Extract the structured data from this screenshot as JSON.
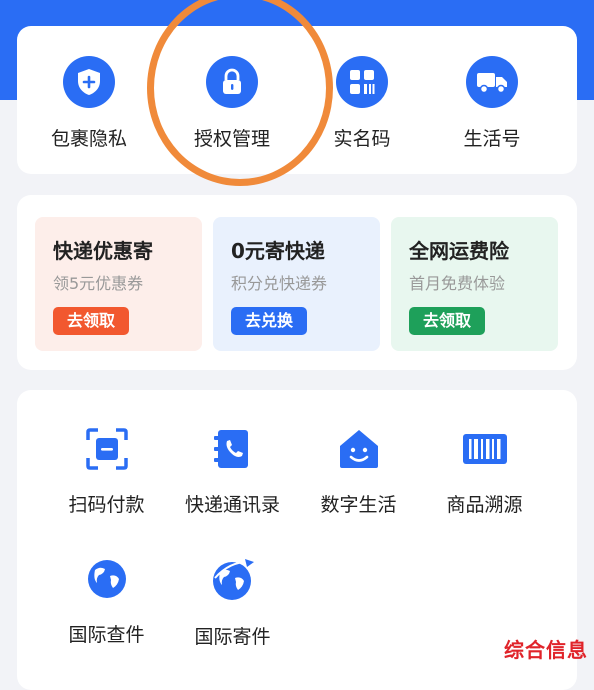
{
  "quick_access": [
    {
      "label": "包裹隐私",
      "icon": "shield-plus-icon"
    },
    {
      "label": "授权管理",
      "icon": "lock-icon"
    },
    {
      "label": "实名码",
      "icon": "qr-grid-icon"
    },
    {
      "label": "生活号",
      "icon": "truck-icon"
    }
  ],
  "promos": [
    {
      "title": "快递优惠寄",
      "subtitle": "领5元优惠券",
      "button": "去领取",
      "bg": "#fdeeea",
      "btn_color": "#f2582f"
    },
    {
      "title": "0元寄快递",
      "subtitle": "积分兑快递券",
      "button": "去兑换",
      "bg": "#e9f1fd",
      "btn_color": "#2a6df4"
    },
    {
      "title": "全网运费险",
      "subtitle": "首月免费体验",
      "button": "去领取",
      "bg": "#e8f7ef",
      "btn_color": "#1ea05a"
    }
  ],
  "services": [
    {
      "label": "扫码付款",
      "icon": "scan-pay-icon"
    },
    {
      "label": "快递通讯录",
      "icon": "phone-book-icon"
    },
    {
      "label": "数字生活",
      "icon": "smile-house-icon"
    },
    {
      "label": "商品溯源",
      "icon": "barcode-icon"
    },
    {
      "label": "国际查件",
      "icon": "globe-icon"
    },
    {
      "label": "国际寄件",
      "icon": "globe-plane-icon"
    }
  ],
  "watermark": "综合信息",
  "colors": {
    "brand_blue": "#2a6df4",
    "highlight_orange": "#f08a3a",
    "watermark_red": "#e0242a"
  }
}
